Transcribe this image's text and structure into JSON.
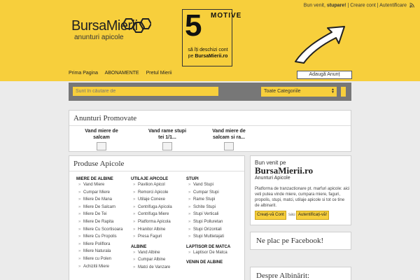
{
  "header": {
    "logo_name": "BursaMierii",
    "logo_tagline": "anunturi apicole",
    "top_links": {
      "welcome": "Bun venit,",
      "user": "stupare!",
      "sep1": " | ",
      "create": "Creare cont",
      "sep2": " | ",
      "login": "Autentificare"
    },
    "promo": {
      "number": "5",
      "word": "MOTIVE",
      "line1": "să îți deschizi cont",
      "line2": "pe",
      "site": "BursaMierii.ro"
    },
    "nav": [
      "Prima Pagina",
      "ABONAMENTE",
      "Pretul Mierii"
    ],
    "add_button": "Adaugă Anunț",
    "colors": {
      "brand_yellow": "#f7cf3c",
      "bar_gray": "#777777"
    }
  },
  "search": {
    "placeholder": "Sunt în căutare de",
    "category": "Toate Categoriile"
  },
  "promoted": {
    "title": "Anunturi Promovate",
    "items": [
      {
        "title": "Vand miere de salcam"
      },
      {
        "title": "Vand rame stupi tei 1/1..."
      },
      {
        "title": "Vand miere de salcam si ra..."
      }
    ]
  },
  "products": {
    "title": "Produse Apicole",
    "columns": [
      {
        "groups": [
          {
            "heading": "MIERE DE ALBINE",
            "items": [
              "Vand Miere",
              "Cumpar Miere",
              "Miere De Mana",
              "Miere De Salcam",
              "Miere De Tei",
              "Miere De Rapita",
              "Miere Cu Scortisoara",
              "Miere Cu Propolis",
              "Miere Poliflora",
              "Miere Naturala",
              "Miere cu Polen",
              "Achizitii Miere"
            ]
          }
        ]
      },
      {
        "groups": [
          {
            "heading": "UTILAJE APICOLE",
            "items": [
              "Pavilion Apicol",
              "Remorci Apicole",
              "Utilaje Conexe",
              "Centrifuga Apicola",
              "Centrifuga Miere",
              "Platforma Apicola",
              "Hranitor Albine",
              "Presa Faguri"
            ]
          },
          {
            "heading": "ALBINE",
            "items": [
              "Vand Albine",
              "Cumpar Albine",
              "Matci de Vanzare"
            ]
          }
        ]
      },
      {
        "groups": [
          {
            "heading": "STUPI",
            "items": [
              "Vand Stupi",
              "Cumpar Stupi",
              "Rame Stupi",
              "Schite Stupi",
              "Stupi Verticali",
              "Stupi Polluretan",
              "Stupi Orizontali",
              "Stupi Multietajati"
            ]
          },
          {
            "heading": "LAPTISOR DE MATCA",
            "items": [
              "Laptisor De Matca"
            ]
          },
          {
            "heading": "VENIN DE ALBINE",
            "items": []
          }
        ]
      }
    ]
  },
  "welcome": {
    "greeting": "Bun venit pe",
    "site": "BursaMierii.ro",
    "subtitle": "Anunturi Apicole",
    "text": "Platforma de tranzactionare pt. marfuri apicole: aici veti putea vinde miere, cumpara miere, faguri, propolis, stupi, matci, utilaje apicole si tot ce tine de albinarit.",
    "create_button": "Creați-vă Cont",
    "or": "sau",
    "login_button": "Autentificați-vă!"
  },
  "facebook": {
    "title": "Ne plac pe Facebook!"
  },
  "despre": {
    "title": "Despre Albinărit:"
  }
}
